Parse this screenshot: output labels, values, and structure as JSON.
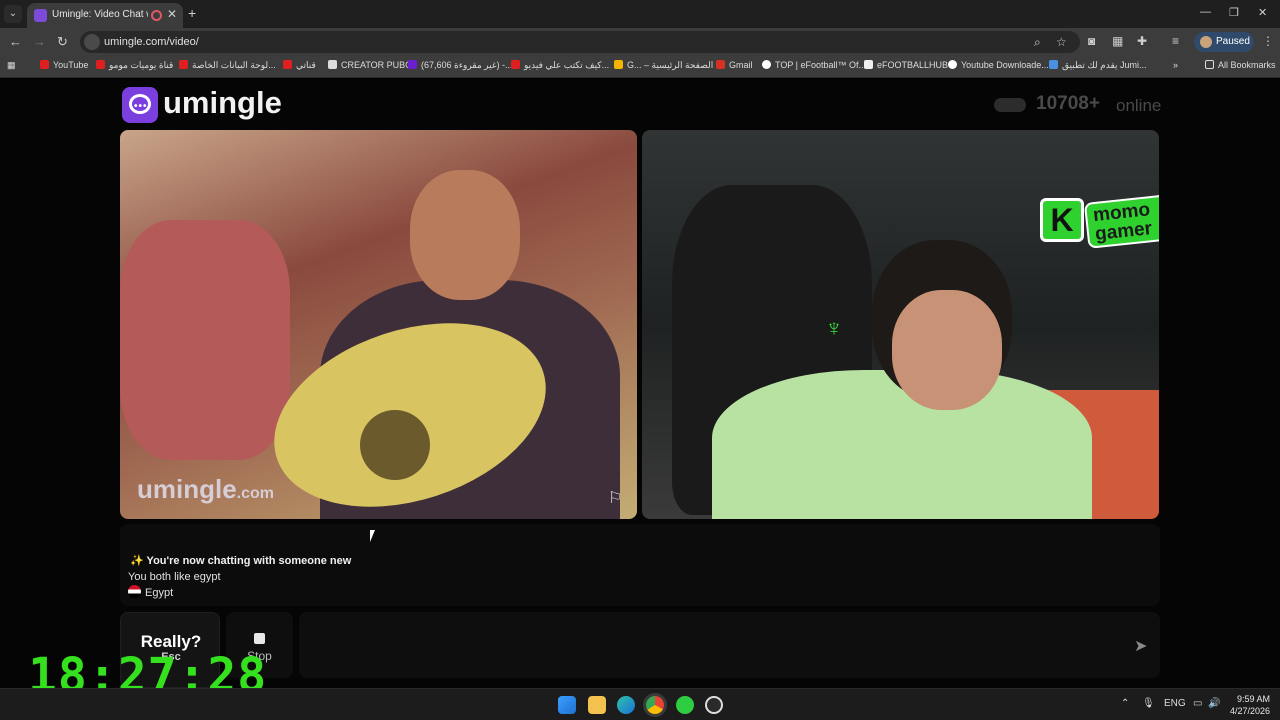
{
  "browser": {
    "tab_title": "Umingle: Video Chat with S",
    "url": "umingle.com/video/",
    "profile_label": "Paused",
    "bookmarks": [
      "YouTube",
      "قناة يوميات مومو",
      "لوحة البيانات الخاصة...",
      "قناتي",
      "CREATOR PUBG",
      "(67,606 غير مقروءة) -...",
      "كيف تكتب علي فيديو...",
      "G... – الصفحة الرئيسية",
      "Gmail",
      "TOP | eFootball™ Of...",
      "eFOOTBALLHUB",
      "Youtube Downloade...",
      "يقدم لك تطبيق Jumi...",
      "All Bookmarks"
    ]
  },
  "page": {
    "brand": "umingle",
    "online_count": "10708+",
    "online_label": "online",
    "watermark_main": "umingle",
    "watermark_suffix": ".com",
    "badge_text": "momo gamer",
    "chat": {
      "headline": "✨ You're now chatting with someone new",
      "common": "You both like egypt",
      "country": "Egypt"
    },
    "skip_label": "Really?",
    "skip_hint": "Esc",
    "stop_label": "Stop",
    "message_placeholder": ""
  },
  "overlay": {
    "timer": "18:27:28"
  },
  "taskbar": {
    "language": "ENG",
    "time": "9:59 AM",
    "date": "4/27/2026"
  },
  "colors": {
    "brand_purple": "#7b3fe0",
    "timer_green": "#35e01e"
  }
}
